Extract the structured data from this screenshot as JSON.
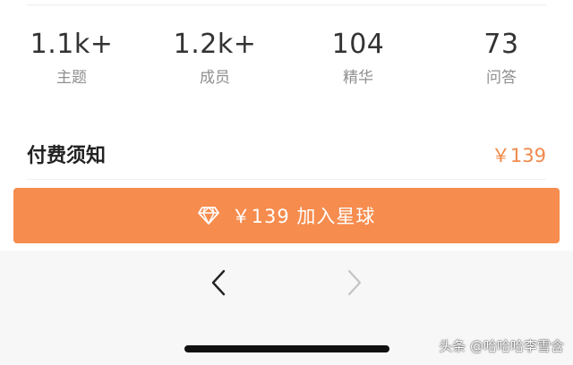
{
  "stats": [
    {
      "value": "1.1k+",
      "label": "主题"
    },
    {
      "value": "1.2k+",
      "label": "成员"
    },
    {
      "value": "104",
      "label": "精华"
    },
    {
      "value": "73",
      "label": "问答"
    }
  ],
  "notice": {
    "title": "付费须知",
    "price": "￥139"
  },
  "join_button": {
    "label": "￥139 加入星球",
    "icon": "diamond-icon"
  },
  "nav": {
    "back_icon": "chevron-left-icon",
    "forward_icon": "chevron-right-icon"
  },
  "watermark": "头条 @哈哈哈李雪含",
  "colors": {
    "accent": "#f68c4e",
    "price": "#f08a4b"
  }
}
